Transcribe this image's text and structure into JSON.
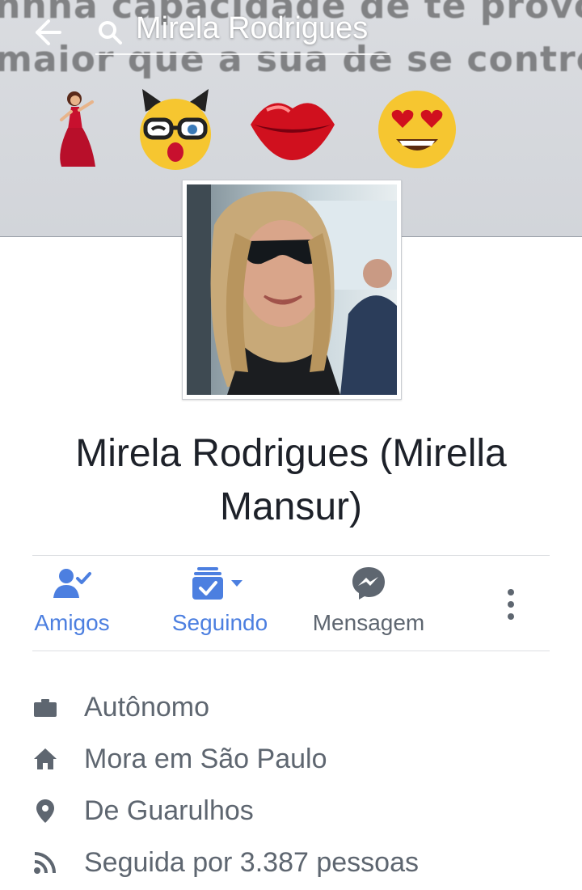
{
  "cover": {
    "line1": "nnha capacidade de te provocar",
    "line2": "maior que a sua de se controlar"
  },
  "header": {
    "title": "Mirela Rodrigues"
  },
  "profile": {
    "name": "Mirela Rodrigues (Mirella Mansur)"
  },
  "actions": {
    "friends_label": "Amigos",
    "following_label": "Seguindo",
    "message_label": "Mensagem"
  },
  "info": {
    "work": "Autônomo",
    "lives": "Mora em São Paulo",
    "from": "De Guarulhos",
    "followers": "Seguida por 3.387 pessoas"
  },
  "colors": {
    "accent": "#4c7fe0",
    "secondary_text": "#5e6670",
    "name_text": "#1d2129"
  }
}
